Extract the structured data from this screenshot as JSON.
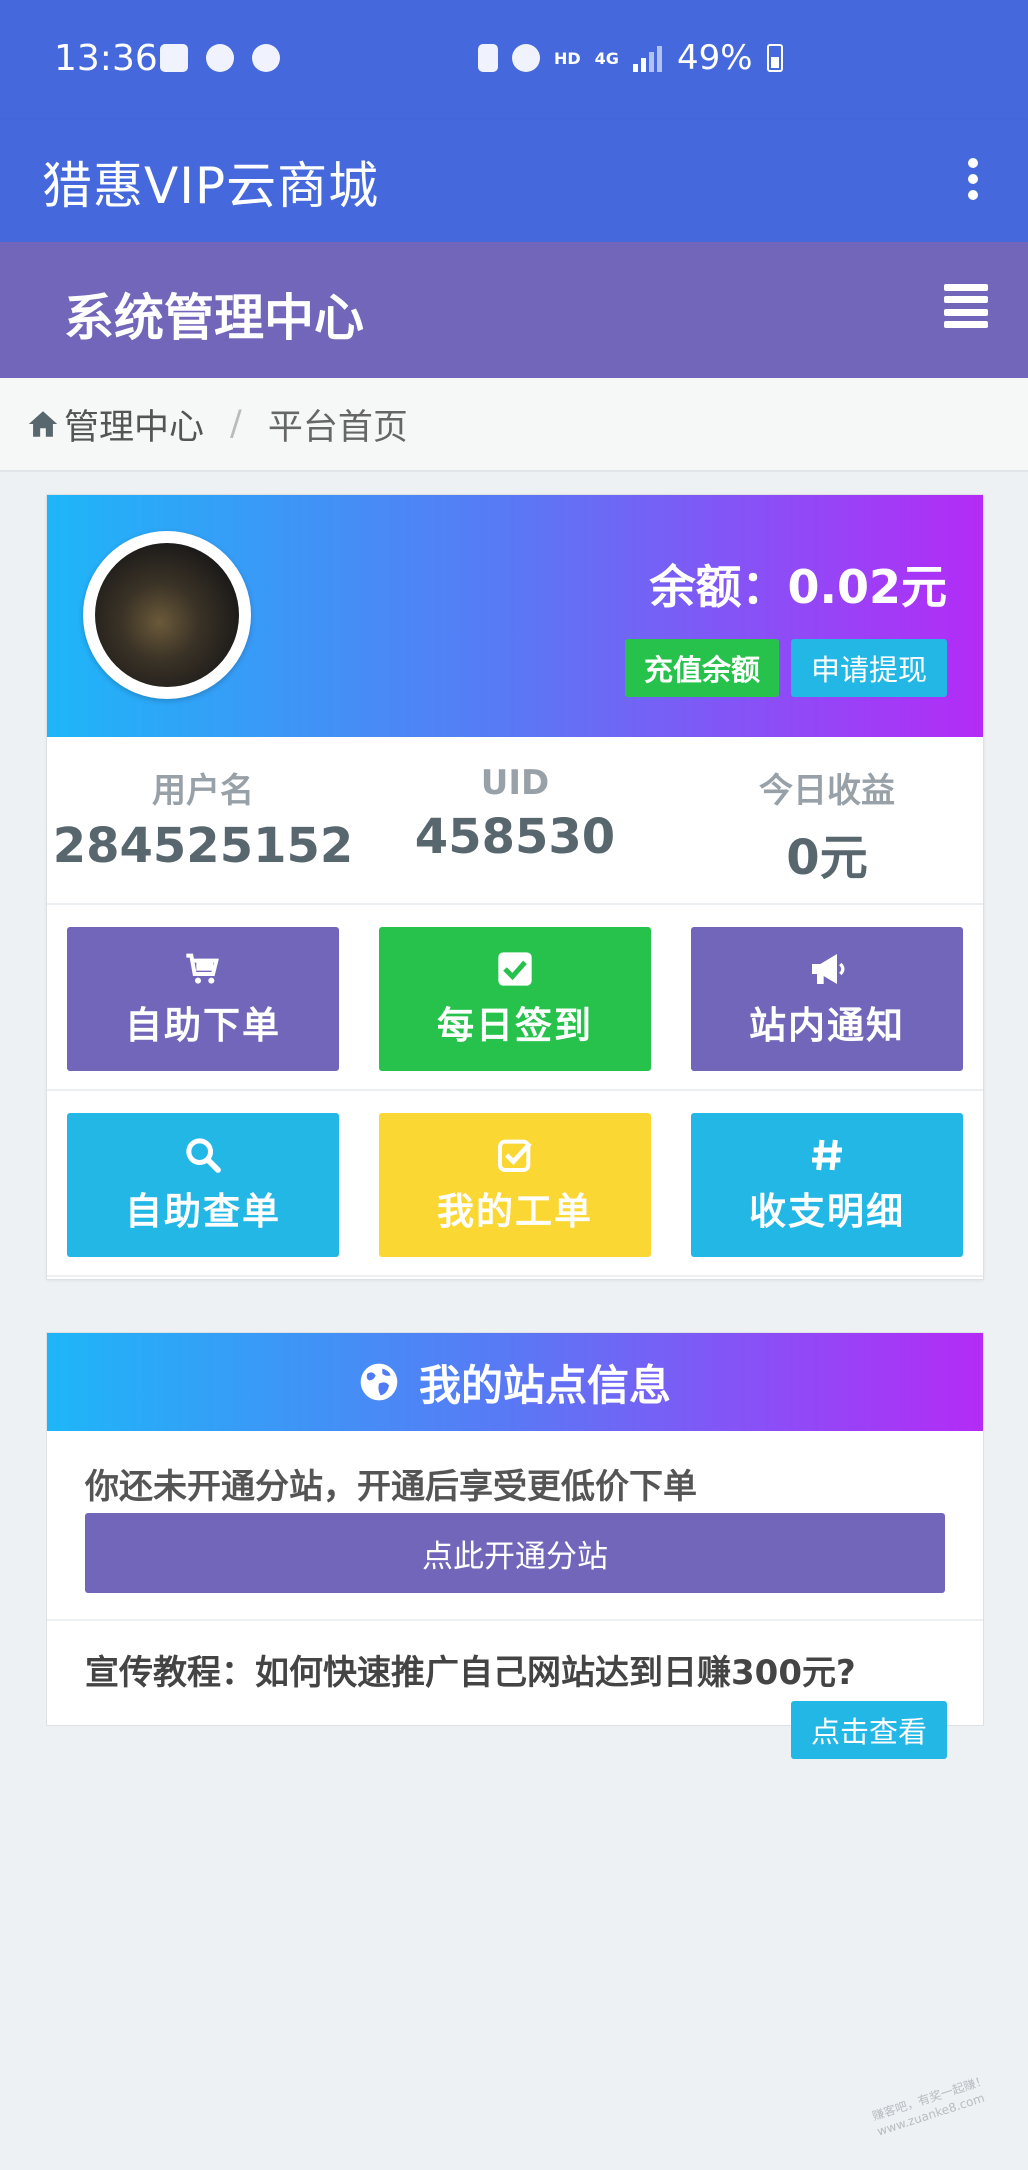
{
  "status": {
    "time": "13:36",
    "network": "4G",
    "hd": "HD",
    "battery": "49%"
  },
  "appbar": {
    "title": "猎惠VIP云商城"
  },
  "sysbar": {
    "title": "系统管理中心"
  },
  "breadcrumb": {
    "home": "管理中心",
    "separator": "/",
    "current": "平台首页"
  },
  "balance": {
    "text": "余额：0.02元",
    "recharge_label": "充值余额",
    "withdraw_label": "申请提现"
  },
  "stats": [
    {
      "label": "用户名",
      "value": "284525152"
    },
    {
      "label": "UID",
      "value": "458530"
    },
    {
      "label": "今日收益",
      "value": "0元"
    }
  ],
  "tiles": [
    {
      "label": "自助下单",
      "icon": "cart-icon",
      "color": "#7266ba"
    },
    {
      "label": "每日签到",
      "icon": "check-square-icon",
      "color": "#27c24c"
    },
    {
      "label": "站内通知",
      "icon": "megaphone-icon",
      "color": "#7266ba"
    },
    {
      "label": "自助查单",
      "icon": "search-icon",
      "color": "#23b7e5"
    },
    {
      "label": "我的工单",
      "icon": "check-outline-icon",
      "color": "#fad733"
    },
    {
      "label": "收支明细",
      "icon": "hashtag-icon",
      "color": "#23b7e5"
    }
  ],
  "site": {
    "title": "我的站点信息",
    "message": "你还未开通分站，开通后享受更低价下单",
    "open_button": "点此开通分站",
    "promo": "宣传教程：如何快速推广自己网站达到日赚300元?",
    "view_button": "点击查看"
  },
  "watermark": {
    "line1": "赚客吧，有奖一起赚！",
    "line2": "www.zuanke8.com"
  },
  "colors": {
    "header_blue": "#4568dc",
    "purple": "#7266ba",
    "green": "#27c24c",
    "info": "#23b7e5",
    "yellow": "#fad733"
  }
}
